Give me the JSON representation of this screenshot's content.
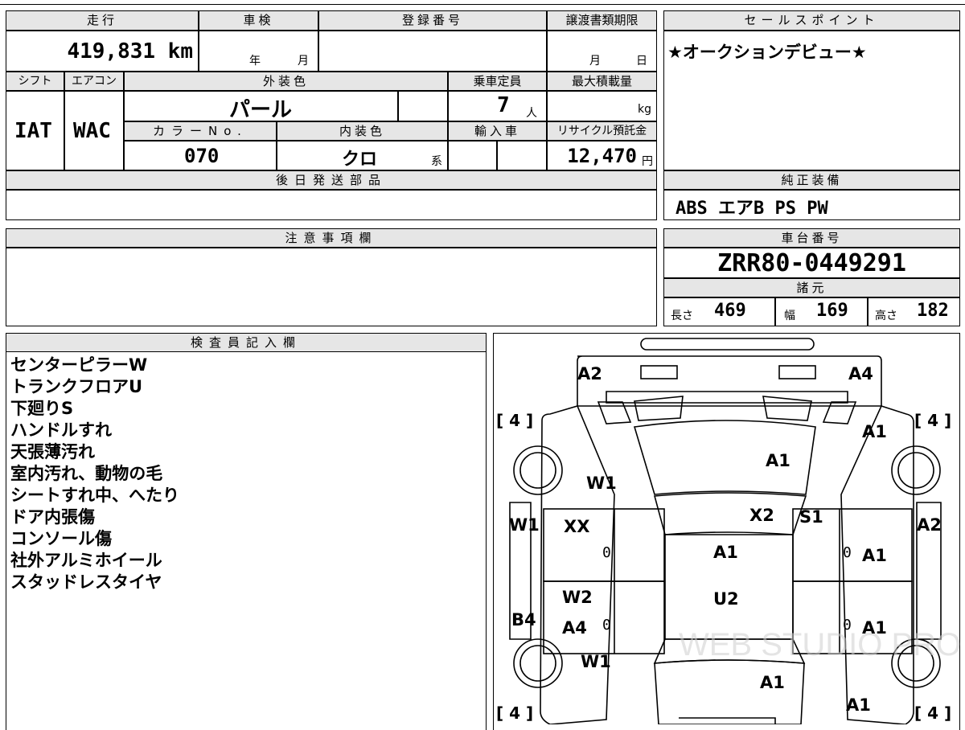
{
  "headers": {
    "mileage": "走行",
    "inspection": "車検",
    "registration_no": "登録番号",
    "transfer_deadline": "譲渡書類期限",
    "sales_point": "セールスポイント",
    "shift": "シフト",
    "aircon": "エアコン",
    "exterior_color": "外装色",
    "capacity": "乗車定員",
    "max_load": "最大積載量",
    "color_no": "カラーNo.",
    "interior_color": "内装色",
    "import": "輸入車",
    "recycle": "リサイクル預託金",
    "later_parts": "後日発送部品",
    "genuine_equipment": "純正装備",
    "notes": "注意事項欄",
    "chassis_no": "車台番号",
    "specs": "諸元",
    "inspector": "検査員記入欄"
  },
  "values": {
    "mileage": "419,831 km",
    "inspection_year": "年",
    "inspection_month": "月",
    "transfer_month": "月",
    "transfer_day": "日",
    "sales_point": "★オークションデビュー★",
    "shift": "IAT",
    "aircon": "WAC",
    "exterior_color": "パール",
    "capacity": "7",
    "capacity_unit": "人",
    "max_load_unit": "kg",
    "color_no": "070",
    "interior_color": "クロ",
    "interior_suffix": "系",
    "recycle": "12,470",
    "recycle_unit": "円",
    "genuine_equipment": "ABS エアB PS PW",
    "chassis_no": "ZRR80-0449291",
    "length_label": "長さ",
    "length": "469",
    "width_label": "幅",
    "width": "169",
    "height_label": "高さ",
    "height": "182"
  },
  "inspector_notes": [
    "センターピラーW",
    "トランクフロアU",
    "下廻りS",
    "ハンドルすれ",
    "天張薄汚れ",
    "室内汚れ、動物の毛",
    "シートすれ中、へたり",
    "ドア内張傷",
    "コンソール傷",
    "社外アルミホイール",
    "スタッドレスタイヤ"
  ],
  "diagram": {
    "codes": {
      "rear_left": "A2",
      "rear_right": "A4",
      "rear_right_quarter": "A1",
      "roof": "A1",
      "rear_left_door": "W1",
      "left_pillar": "W1",
      "rear_left_area": "XX",
      "center_top": "X2",
      "right_pillar": "S1",
      "right_panel": "A2",
      "center_middle": "A1",
      "right_rear_door": "A1",
      "front_left_door": "W2",
      "center_lower": "U2",
      "left_sill": "B4",
      "front_left_door_lower": "A4",
      "right_front_door": "A1",
      "front_left_fender": "W1",
      "hood": "A1",
      "front_right_fender": "A1"
    },
    "tread": {
      "rl": "[ 4 ]",
      "rr": "[ 4 ]",
      "fl": "[ 4 ]",
      "fr": "[ 4 ]"
    },
    "zeros": "0",
    "watermark": "WEB STUDIO PRO"
  }
}
